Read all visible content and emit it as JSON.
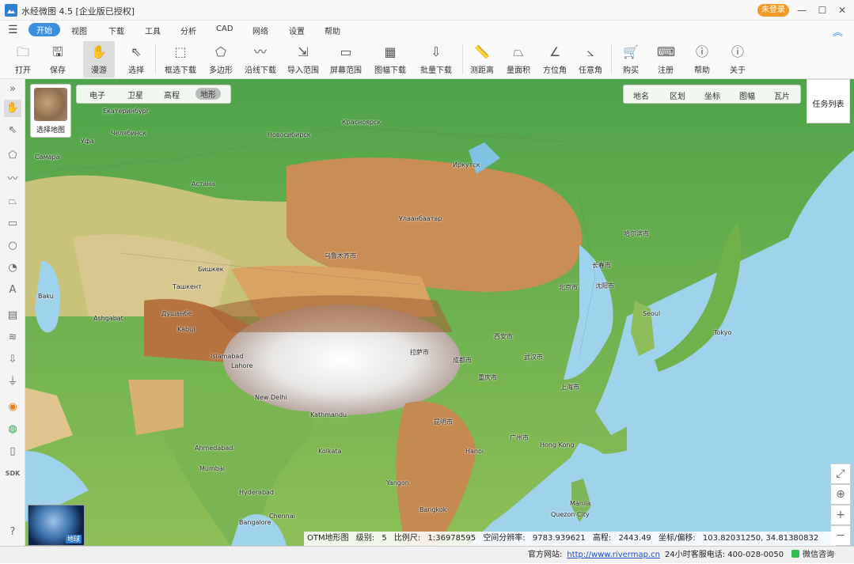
{
  "window": {
    "title": "水经微图 4.5 [企业版已授权]",
    "login_label": "未登录",
    "min": "—",
    "max": "☐",
    "close": "✕"
  },
  "menu": {
    "items": [
      "开始",
      "视图",
      "下载",
      "工具",
      "分析",
      "CAD",
      "网络",
      "设置",
      "帮助"
    ],
    "active": "开始"
  },
  "toolbar": {
    "items": [
      "打开",
      "保存",
      "漫游",
      "选择",
      "框选下载",
      "多边形",
      "沿线下载",
      "导入范围",
      "屏幕范围",
      "图幅下载",
      "批量下载",
      "测距离",
      "量面积",
      "方位角",
      "任意角",
      "购买",
      "注册",
      "帮助",
      "关于"
    ]
  },
  "left_tools": [
    "collapse-icon",
    "hand-icon",
    "cursor-icon",
    "polygon-icon",
    "line-icon",
    "area-icon",
    "rect-icon",
    "circle-icon",
    "arc-icon",
    "text-icon",
    "save-icon",
    "stack-icon",
    "download-icon",
    "ruler-icon",
    "globe-icon",
    "earth-icon",
    "phone-icon",
    "SDK",
    "help-icon"
  ],
  "map": {
    "select_map_label": "选择地图",
    "map_types": [
      "电子",
      "卫星",
      "高程",
      "地形"
    ],
    "active_map_type": "地形",
    "layers": [
      "地名",
      "区划",
      "坐标",
      "图幅",
      "瓦片"
    ],
    "task_list": "任务列表",
    "globe_tag": "地球",
    "labels": [
      {
        "t": "Екатеринбург"
      },
      {
        "t": "Челябинск"
      },
      {
        "t": "Уфа"
      },
      {
        "t": "Самара"
      },
      {
        "t": "Астана"
      },
      {
        "t": "Новосибирск"
      },
      {
        "t": "Красноярск"
      },
      {
        "t": "Иркутск"
      },
      {
        "t": "Улаанбаатар"
      },
      {
        "t": "Бишкек"
      },
      {
        "t": "Ташкент"
      },
      {
        "t": "Душанбе"
      },
      {
        "t": "Ashgabat"
      },
      {
        "t": "Baku"
      },
      {
        "t": "Kabul"
      },
      {
        "t": "Islamabad"
      },
      {
        "t": "Lahore"
      },
      {
        "t": "New Delhi"
      },
      {
        "t": "Kathmandu"
      },
      {
        "t": "Kolkata"
      },
      {
        "t": "Ahmedabad"
      },
      {
        "t": "Mumbai"
      },
      {
        "t": "Hyderabad"
      },
      {
        "t": "Bangalore"
      },
      {
        "t": "Chennai"
      },
      {
        "t": "Yangon"
      },
      {
        "t": "Bangkok"
      },
      {
        "t": "Hanoi"
      },
      {
        "t": "Hong Kong"
      },
      {
        "t": "Manila"
      },
      {
        "t": "Quezon City"
      },
      {
        "t": "Seoul"
      },
      {
        "t": "Tokyo"
      },
      {
        "t": "北京市"
      },
      {
        "t": "上海市"
      },
      {
        "t": "哈尔滨市"
      },
      {
        "t": "长春市"
      },
      {
        "t": "沈阳市"
      },
      {
        "t": "乌鲁木齐市"
      },
      {
        "t": "拉萨市"
      },
      {
        "t": "成都市"
      },
      {
        "t": "重庆市"
      },
      {
        "t": "西安市"
      },
      {
        "t": "武汉市"
      },
      {
        "t": "广州市"
      },
      {
        "t": "昆明市"
      }
    ]
  },
  "status": {
    "source": "OTM地形图",
    "level_label": "级别:",
    "level": "5",
    "scale_label": "比例尺:",
    "scale": "1:36978595",
    "res_label": "空间分辨率:",
    "res": "9783.939621",
    "elev_label": "高程:",
    "elev": "2443.49",
    "coord_label": "坐标/偏移:",
    "coord": "103.82031250, 34.81380832"
  },
  "statusbar": {
    "web_label": "官方网站:",
    "url": "http://www.rivermap.cn",
    "phone": "24小时客服电话: 400-028-0050",
    "wechat": "微信咨询"
  }
}
